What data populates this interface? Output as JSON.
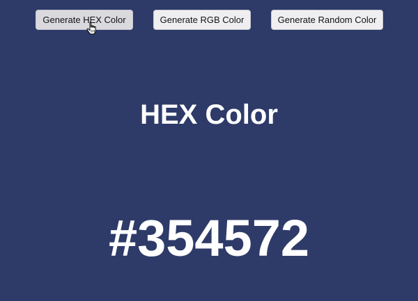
{
  "buttons": {
    "hex_label": "Generate HEX Color",
    "rgb_label": "Generate RGB Color",
    "random_label": "Generate Random Color"
  },
  "display": {
    "title": "HEX Color",
    "value": "#354572"
  },
  "colors": {
    "background": "#2e3b69",
    "text": "#ffffff",
    "button_bg": "#efeff1"
  },
  "cursor": {
    "icon": "hand-pointer-icon"
  }
}
